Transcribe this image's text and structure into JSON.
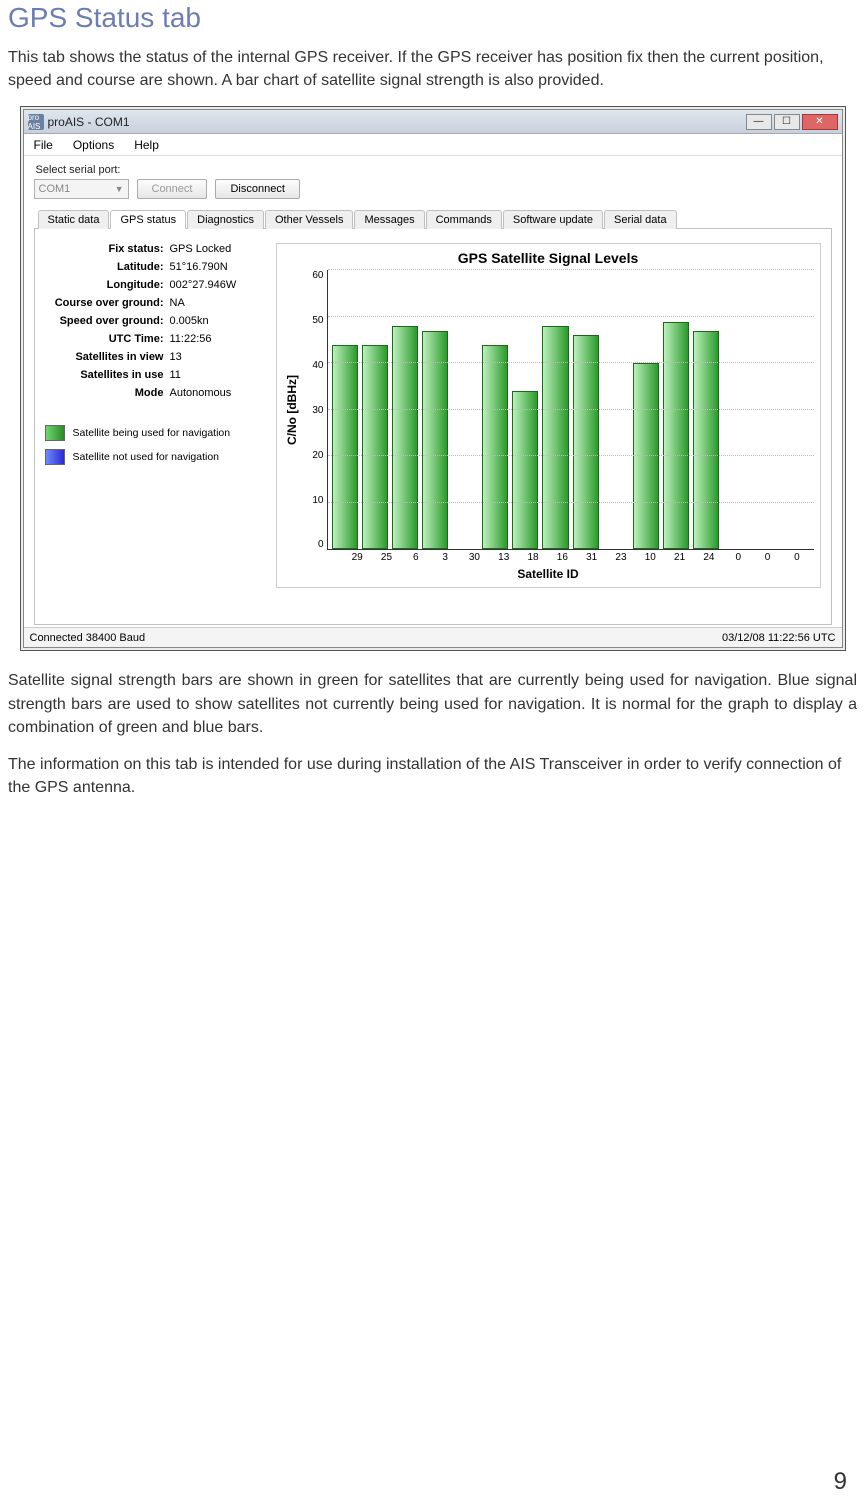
{
  "heading": "GPS Status tab",
  "intro": "This tab shows the status of the internal GPS receiver. If the GPS receiver has position fix then the current position, speed and course are shown. A bar chart of satellite signal strength is also provided.",
  "para2": "Satellite signal strength bars are shown in green for satellites that are currently being used for navigation. Blue signal strength bars are used to show satellites not currently being used for navigation. It is normal for the graph to display a combination of green and blue bars.",
  "para3": "The information on this tab is intended for use during installation of the AIS Transceiver in order to verify connection of the GPS antenna.",
  "page_number": "9",
  "window": {
    "app_icon_text": "pro AIS",
    "title": "proAIS - COM1",
    "menu": [
      "File",
      "Options",
      "Help"
    ],
    "port_label": "Select serial port:",
    "port_value": "COM1",
    "connect_btn": "Connect",
    "disconnect_btn": "Disconnect",
    "tabs": [
      "Static data",
      "GPS status",
      "Diagnostics",
      "Other Vessels",
      "Messages",
      "Commands",
      "Software update",
      "Serial data"
    ],
    "active_tab_index": 1,
    "status_left": "Connected    38400 Baud",
    "status_right": "03/12/08  11:22:56 UTC"
  },
  "gps_status": {
    "rows": [
      {
        "k": "Fix status:",
        "v": "GPS Locked"
      },
      {
        "k": "Latitude:",
        "v": "51°16.790N"
      },
      {
        "k": "Longitude:",
        "v": "002°27.946W"
      },
      {
        "k": "Course over ground:",
        "v": "NA"
      },
      {
        "k": "Speed over ground:",
        "v": "0.005kn"
      },
      {
        "k": "UTC Time:",
        "v": "11:22:56"
      },
      {
        "k": "Satellites in view",
        "v": "13"
      },
      {
        "k": "Satellites in use",
        "v": "11"
      },
      {
        "k": "Mode",
        "v": "Autonomous"
      }
    ],
    "legend_green": "Satellite being used for navigation",
    "legend_blue": "Satellite not used for navigation"
  },
  "chart_data": {
    "type": "bar",
    "title": "GPS Satellite Signal Levels",
    "xlabel": "Satellite ID",
    "ylabel": "C/No [dBHz]",
    "ylim": [
      0,
      60
    ],
    "yticks": [
      0,
      10,
      20,
      30,
      40,
      50,
      60
    ],
    "categories": [
      "29",
      "25",
      "6",
      "3",
      "30",
      "13",
      "18",
      "16",
      "31",
      "23",
      "10",
      "21",
      "24",
      "0",
      "0",
      "0"
    ],
    "values": [
      44,
      44,
      48,
      47,
      0,
      44,
      34,
      48,
      46,
      0,
      40,
      49,
      47,
      0,
      0,
      0
    ]
  }
}
